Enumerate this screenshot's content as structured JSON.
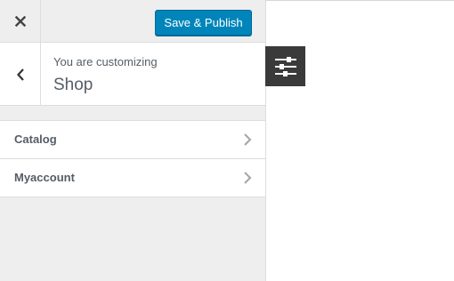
{
  "header": {
    "close_icon": "close-icon",
    "publish_label": "Save & Publish",
    "publish_color": "#0085ba"
  },
  "section_info": {
    "back_icon": "chevron-left-icon",
    "customizing_label": "You are customizing",
    "title": "Shop"
  },
  "panels": [
    {
      "label": "Catalog",
      "icon": "chevron-right-icon"
    },
    {
      "label": "Myaccount",
      "icon": "chevron-right-icon"
    }
  ],
  "settings_toggle": {
    "icon": "sliders-icon",
    "background": "#3a3a3a"
  }
}
